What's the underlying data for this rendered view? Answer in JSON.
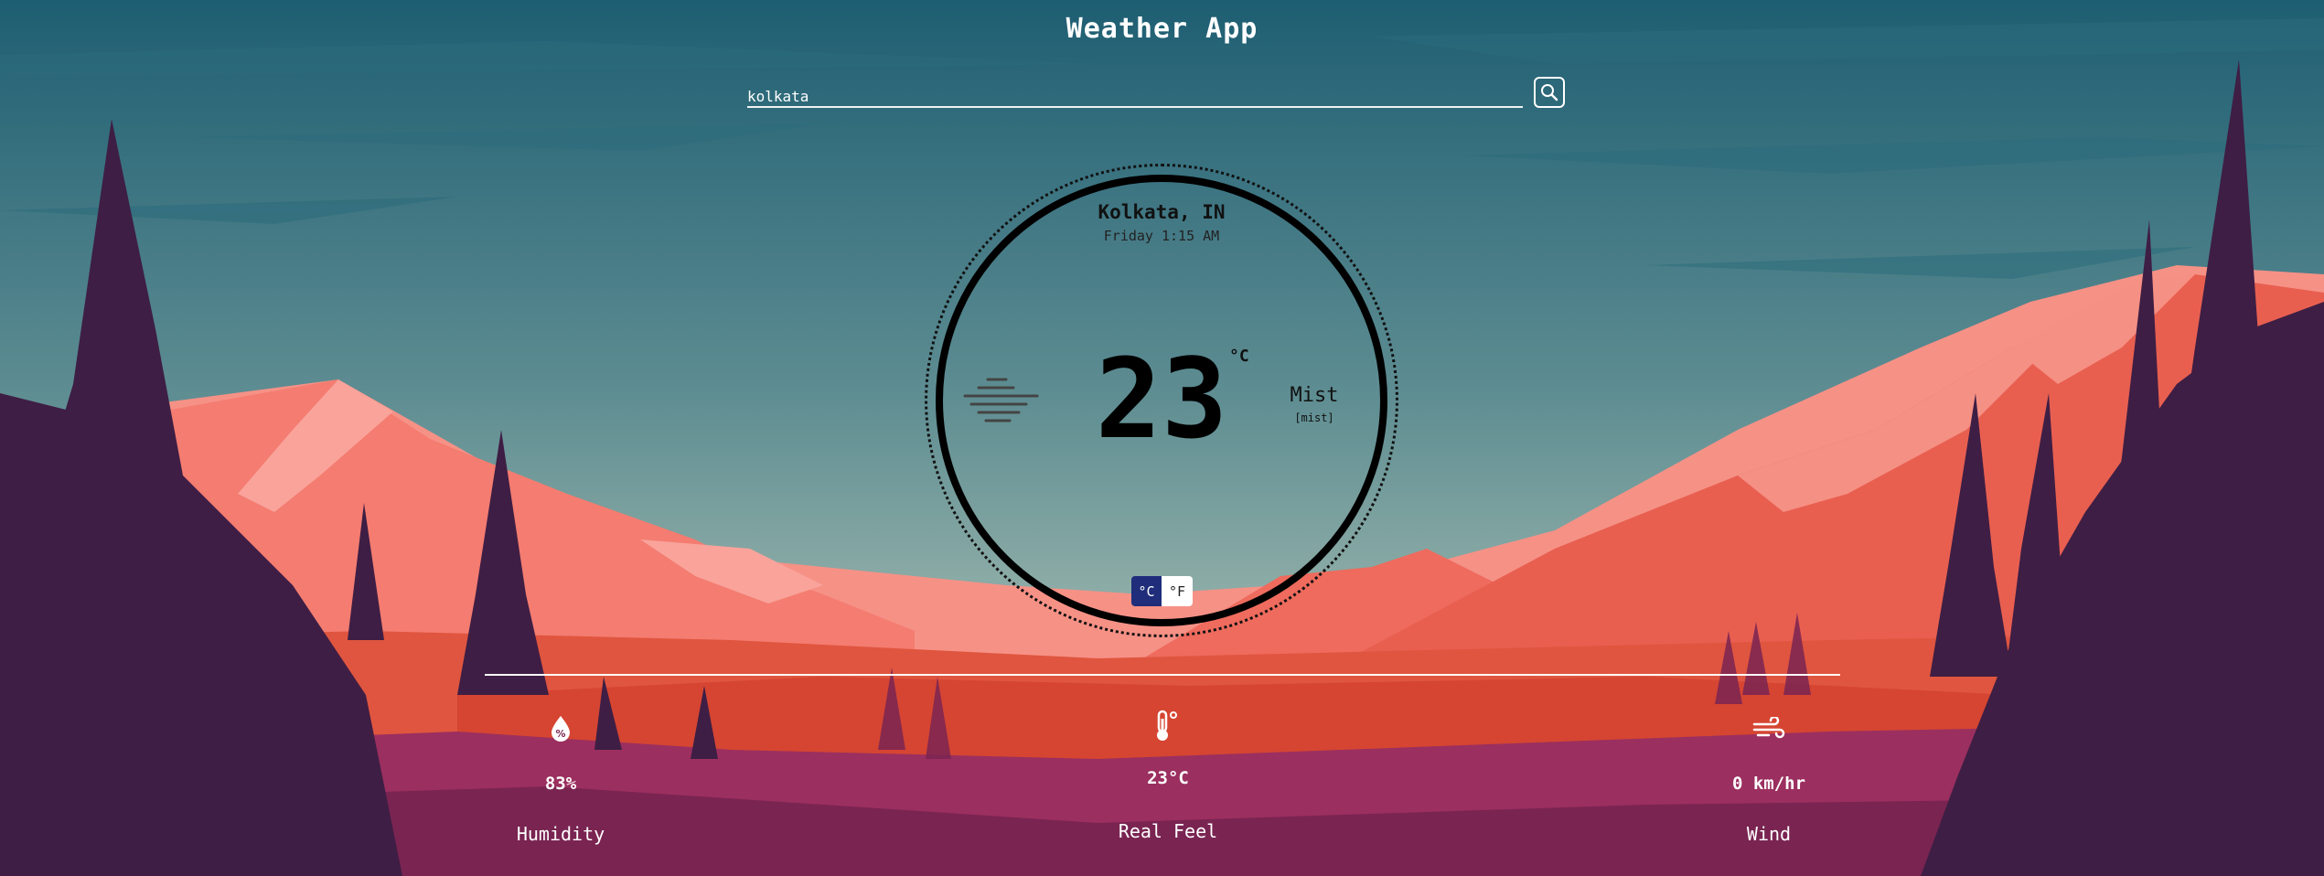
{
  "app": {
    "title": "Weather App"
  },
  "search": {
    "value": "kolkata",
    "icon": "search-icon"
  },
  "current": {
    "city": "Kolkata, IN",
    "datetime": "Friday 1:15 AM",
    "temperature": "23",
    "unit_symbol": "°C",
    "condition": "Mist",
    "condition_detail": "[mist]",
    "condition_icon": "mist-icon"
  },
  "unit_toggle": {
    "celsius": "°C",
    "fahrenheit": "°F",
    "active": "celsius"
  },
  "stats": {
    "humidity": {
      "value": "83%",
      "label": "Humidity",
      "icon": "humidity-icon"
    },
    "real_feel": {
      "value": "23°C",
      "label": "Real Feel",
      "icon": "thermometer-icon"
    },
    "wind": {
      "value": "0 km/hr",
      "label": "Wind",
      "icon": "wind-icon"
    }
  },
  "colors": {
    "sky_top": "#1e5e72",
    "sky_bottom": "#9cb6ad",
    "mountain_light": "#f47c70",
    "mountain_dark": "#e0553f",
    "hill_magenta": "#9b2f5f",
    "trees": "#3e1e44",
    "toggle_active": "#1f2d7a"
  }
}
